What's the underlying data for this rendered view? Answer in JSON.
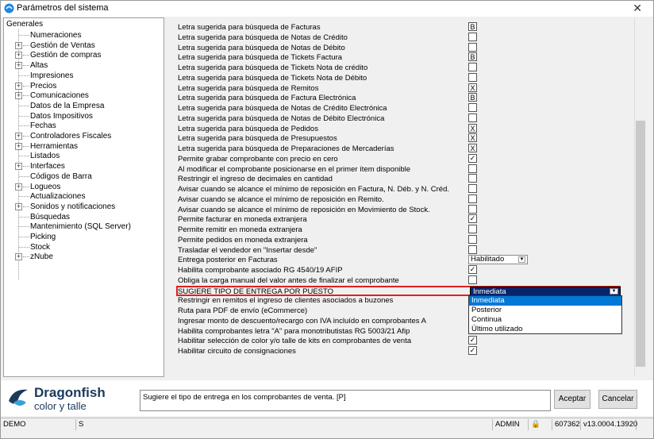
{
  "window": {
    "title": "Parámetros del sistema",
    "close": "✕"
  },
  "tree": {
    "root": "Generales",
    "items": [
      {
        "label": "Numeraciones",
        "expandable": false
      },
      {
        "label": "Gestión de Ventas",
        "expandable": true
      },
      {
        "label": "Gestión de compras",
        "expandable": true
      },
      {
        "label": "Altas",
        "expandable": true
      },
      {
        "label": "Impresiones",
        "expandable": false
      },
      {
        "label": "Precios",
        "expandable": true
      },
      {
        "label": "Comunicaciones",
        "expandable": true
      },
      {
        "label": "Datos de la Empresa",
        "expandable": false
      },
      {
        "label": "Datos Impositivos",
        "expandable": false
      },
      {
        "label": "Fechas",
        "expandable": false
      },
      {
        "label": "Controladores Fiscales",
        "expandable": true
      },
      {
        "label": "Herramientas",
        "expandable": true
      },
      {
        "label": "Listados",
        "expandable": false
      },
      {
        "label": "Interfaces",
        "expandable": true
      },
      {
        "label": "Códigos de Barra",
        "expandable": false
      },
      {
        "label": "Logueos",
        "expandable": true
      },
      {
        "label": "Actualizaciones",
        "expandable": false
      },
      {
        "label": "Sonidos y notificaciones",
        "expandable": true
      },
      {
        "label": "Búsquedas",
        "expandable": false
      },
      {
        "label": "Mantenimiento (SQL Server)",
        "expandable": false
      },
      {
        "label": "Picking",
        "expandable": false
      },
      {
        "label": "Stock",
        "expandable": false
      },
      {
        "label": "zNube",
        "expandable": true
      }
    ]
  },
  "rows": [
    {
      "label": "Letra sugerida para búsqueda de Facturas",
      "kind": "letter",
      "value": "B"
    },
    {
      "label": "Letra sugerida para búsqueda de Notas de Crédito",
      "kind": "letter",
      "value": ""
    },
    {
      "label": "Letra sugerida para búsqueda de Notas de Débito",
      "kind": "letter",
      "value": ""
    },
    {
      "label": "Letra sugerida para búsqueda de Tickets Factura",
      "kind": "letter",
      "value": "B"
    },
    {
      "label": "Letra sugerida para búsqueda de Tickets Nota de crédito",
      "kind": "letter",
      "value": ""
    },
    {
      "label": "Letra sugerida para búsqueda de Tickets Nota de Débito",
      "kind": "letter",
      "value": ""
    },
    {
      "label": "Letra sugerida para búsqueda de Remitos",
      "kind": "letter",
      "value": "X"
    },
    {
      "label": "Letra sugerida para búsqueda de Factura Electrónica",
      "kind": "letter",
      "value": "B"
    },
    {
      "label": "Letra sugerida para búsqueda de Notas de Crédito Electrónica",
      "kind": "letter",
      "value": ""
    },
    {
      "label": "Letra sugerida para búsqueda de Notas de Débito Electrónica",
      "kind": "letter",
      "value": ""
    },
    {
      "label": "Letra sugerida para búsqueda de Pedidos",
      "kind": "letter",
      "value": "X"
    },
    {
      "label": "Letra sugerida para búsqueda de Presupuestos",
      "kind": "letter",
      "value": "X"
    },
    {
      "label": "Letra sugerida para búsqueda de Preparaciones de Mercaderías",
      "kind": "letter",
      "value": "X"
    },
    {
      "label": "Permite grabar comprobante con precio en cero",
      "kind": "check",
      "value": "✓"
    },
    {
      "label": "Al modificar el comprobante posicionarse en el primer ítem disponible",
      "kind": "check",
      "value": ""
    },
    {
      "label": "Restringir el ingreso de decimales en cantidad",
      "kind": "check",
      "value": ""
    },
    {
      "label": "Avisar cuando se alcance el mínimo de reposición en Factura, N. Déb. y N. Créd.",
      "kind": "check",
      "value": ""
    },
    {
      "label": "Avisar cuando se alcance el mínimo de reposición en Remito.",
      "kind": "check",
      "value": ""
    },
    {
      "label": "Avisar cuando se alcance el mínimo de reposición en Movimiento de Stock.",
      "kind": "check",
      "value": ""
    },
    {
      "label": "Permite facturar en moneda extranjera",
      "kind": "check",
      "value": "✓"
    },
    {
      "label": "Permite remitir en moneda extranjera",
      "kind": "check",
      "value": ""
    },
    {
      "label": "Permite pedidos en moneda extranjera",
      "kind": "check",
      "value": ""
    },
    {
      "label": "Trasladar el vendedor en \"Insertar desde\"",
      "kind": "check",
      "value": ""
    },
    {
      "label": "Entrega posterior en Facturas",
      "kind": "combo",
      "value": "Habilitado"
    },
    {
      "label": "Habilita comprobante asociado RG 4540/19 AFIP",
      "kind": "check",
      "value": "✓"
    },
    {
      "label": "Obliga la carga manual del valor antes de finalizar el comprobante",
      "kind": "check",
      "value": ""
    },
    {
      "label": "SUGIERE TIPO DE ENTREGA POR PUESTO",
      "kind": "active",
      "value": "Inmediata"
    },
    {
      "label": "Restringir en remitos el ingreso de clientes asociados a buzones",
      "kind": "none",
      "value": ""
    },
    {
      "label": "Ruta para PDF de envío (eCommerce)",
      "kind": "none",
      "value": ""
    },
    {
      "label": "Ingresar monto de descuento/recargo con IVA incluído en comprobantes A",
      "kind": "none",
      "value": ""
    },
    {
      "label": "Habilita comprobantes letra \"A\" para monotributistas RG 5003/21 Afip",
      "kind": "none",
      "value": ""
    },
    {
      "label": "Habilitar selección de color y/o talle de kits en comprobantes de venta",
      "kind": "check",
      "value": "✓"
    },
    {
      "label": "Habilitar circuito de consignaciones",
      "kind": "check",
      "value": "✓"
    }
  ],
  "dropdown": {
    "options": [
      "Inmediata",
      "Posterior",
      "Continua",
      "Último utilizado"
    ],
    "selected": 0
  },
  "brand": {
    "name": "Dragonfish",
    "tagline": "color y talle"
  },
  "description": "Sugiere el tipo de entrega en los comprobantes de venta. [P]",
  "buttons": {
    "accept": "Aceptar",
    "cancel": "Cancelar"
  },
  "status": {
    "db": "DEMO",
    "mode": "S",
    "user": "ADMIN",
    "lock": "🔒",
    "serial": "607362",
    "version": "v13.0004.13920"
  },
  "colors": {
    "highlight_border": "#e02020",
    "selection": "#0078d7",
    "brand": "#1b3a5c"
  }
}
